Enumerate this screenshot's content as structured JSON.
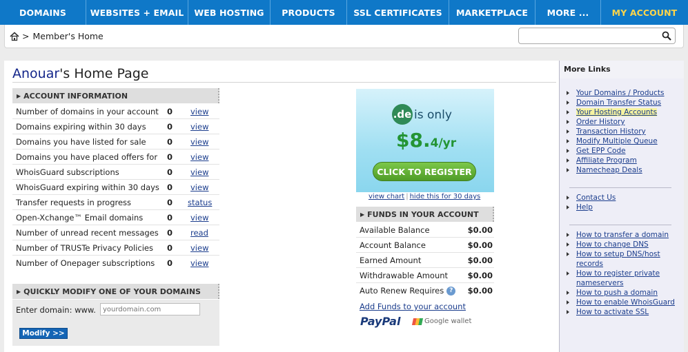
{
  "nav": {
    "items": [
      "DOMAINS",
      "WEBSITES + EMAIL",
      "WEB HOSTING",
      "PRODUCTS",
      "SSL CERTIFICATES",
      "MARKETPLACE",
      "MORE ...",
      "MY ACCOUNT"
    ],
    "active": "MY ACCOUNT",
    "bg_color": "#0f78c8",
    "active_color": "#ffd54a"
  },
  "breadcrumb": {
    "separator": ">",
    "current": "Member's Home"
  },
  "search": {
    "value": "",
    "placeholder": ""
  },
  "page": {
    "username": "Anouar",
    "title_suffix": "'s Home Page"
  },
  "account_info": {
    "header": "ACCOUNT INFORMATION",
    "rows": [
      {
        "label": "Number of domains in your account",
        "count": "0",
        "action": "view"
      },
      {
        "label": "Domains expiring within 30 days",
        "count": "0",
        "action": "view"
      },
      {
        "label": "Domains you have listed for sale",
        "count": "0",
        "action": "view"
      },
      {
        "label": "Domains you have placed offers for",
        "count": "0",
        "action": "view"
      },
      {
        "label": "WhoisGuard subscriptions",
        "count": "0",
        "action": "view"
      },
      {
        "label": "WhoisGuard expiring within 30 days",
        "count": "0",
        "action": "view"
      },
      {
        "label": "Transfer requests in progress",
        "count": "0",
        "action": "status"
      },
      {
        "label": "Open-Xchange™ Email domains",
        "count": "0",
        "action": "view"
      },
      {
        "label": "Number of unread recent messages",
        "count": "0",
        "action": "read"
      },
      {
        "label": "Number of TRUSTe Privacy Policies",
        "count": "0",
        "action": "view"
      },
      {
        "label": "Number of Onepager subscriptions",
        "count": "0",
        "action": "view"
      }
    ]
  },
  "quick_modify": {
    "header": "QUICKLY MODIFY ONE OF YOUR DOMAINS",
    "label": "Enter domain:  www.",
    "placeholder": "yourdomain.com",
    "button": "Modify >>"
  },
  "promo": {
    "tld": ".de",
    "is_only": "is only",
    "price": "$8.",
    "price_tail": "4/yr",
    "cta": "CLICK TO REGISTER",
    "link_chart": "view chart",
    "link_separator": "|",
    "link_hide": "hide this for 30 days"
  },
  "funds": {
    "header": "FUNDS IN YOUR ACCOUNT",
    "rows": [
      {
        "label": "Available Balance",
        "amount": "$0.00"
      },
      {
        "label": "Account Balance",
        "amount": "$0.00"
      },
      {
        "label": "Earned Amount",
        "amount": "$0.00"
      },
      {
        "label": "Withdrawable Amount",
        "amount": "$0.00"
      },
      {
        "label": "Auto Renew Requires",
        "amount": "$0.00",
        "help": "?"
      }
    ],
    "add_funds": "Add Funds to your account",
    "paypal": "PayPal",
    "google_wallet": "Google wallet"
  },
  "more_links": {
    "title": "More Links",
    "group1": [
      "Your Domains / Products",
      "Domain Transfer Status",
      "Your Hosting Accounts",
      "Order History",
      "Transaction History",
      "Modify Multiple Queue",
      "Get EPP Code",
      "Affiliate Program",
      "Namecheap Deals"
    ],
    "highlighted": "Your Hosting Accounts",
    "group2": [
      "Contact Us",
      "Help"
    ],
    "group3": [
      "How to transfer a domain",
      "How to change DNS",
      "How to setup DNS/host records",
      "How to register private nameservers",
      "How to push a domain",
      "How to enable WhoisGuard",
      "How to activate SSL"
    ]
  }
}
